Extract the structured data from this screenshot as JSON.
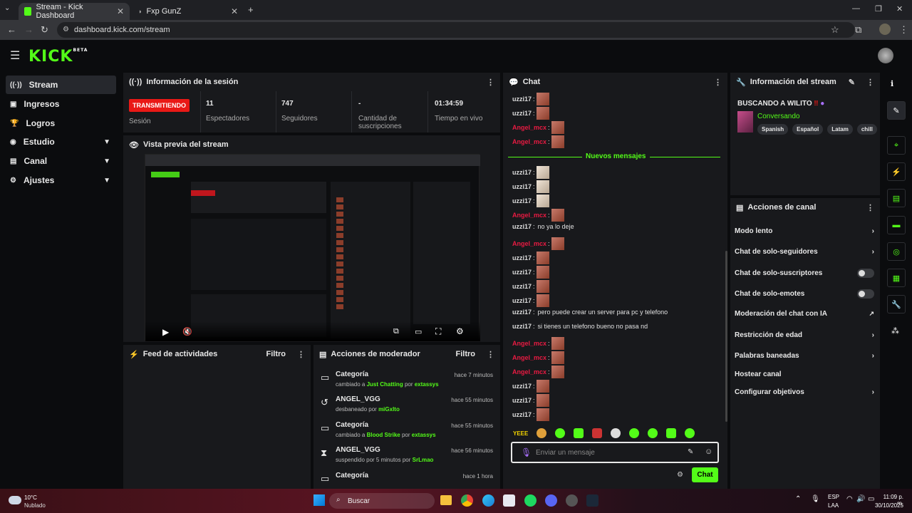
{
  "browser": {
    "tabs": [
      {
        "title": "Stream - Kick Dashboard",
        "active": true
      },
      {
        "title": "Fxp GunZ",
        "active": false
      }
    ],
    "url": "dashboard.kick.com/stream"
  },
  "header": {
    "logo": "KICK",
    "beta": "BETA"
  },
  "sidebar": {
    "items": [
      {
        "label": "Stream",
        "icon": "broadcast-icon"
      },
      {
        "label": "Ingresos",
        "icon": "money-icon"
      },
      {
        "label": "Logros",
        "icon": "trophy-icon"
      },
      {
        "label": "Estudio",
        "icon": "studio-icon"
      },
      {
        "label": "Canal",
        "icon": "channel-icon"
      },
      {
        "label": "Ajustes",
        "icon": "gear-icon"
      }
    ]
  },
  "session": {
    "title": "Información de la sesión",
    "live_badge": "TRANSMITIENDO",
    "session_label": "Sesión",
    "stats": [
      {
        "value": "11",
        "label": "Espectadores"
      },
      {
        "value": "747",
        "label": "Seguidores"
      },
      {
        "value": "-",
        "label": "Cantidad de suscripciones"
      },
      {
        "value": "01:34:59",
        "label": "Tiempo en vivo"
      }
    ]
  },
  "preview": {
    "title": "Vista previa del stream"
  },
  "activity": {
    "title": "Feed de actividades",
    "filter": "Filtro"
  },
  "moderator": {
    "title": "Acciones de moderador",
    "filter": "Filtro",
    "items": [
      {
        "title": "Categoría",
        "time": "hace 7 minutos",
        "pre": "cambiado a",
        "target": "Just Chatting",
        "mid": "por",
        "by": "extassys"
      },
      {
        "title": "ANGEL_VGG",
        "time": "hace 55 minutos",
        "pre": "desbaneado por",
        "target": "",
        "mid": "",
        "by": "miGxlto"
      },
      {
        "title": "Categoría",
        "time": "hace 55 minutos",
        "pre": "cambiado a",
        "target": "Blood Strike",
        "mid": "por",
        "by": "extassys"
      },
      {
        "title": "ANGEL_VGG",
        "time": "hace 56 minutos",
        "pre": "suspendido por 5 minutos por",
        "target": "",
        "mid": "",
        "by": "SrLmao"
      },
      {
        "title": "Categoría",
        "time": "hace 1 hora",
        "pre": "",
        "target": "",
        "mid": "",
        "by": ""
      }
    ]
  },
  "chat": {
    "title": "Chat",
    "new_messages": "Nuevos mensajes",
    "messages": [
      {
        "user": "uzzi17",
        "text": "",
        "emote": true
      },
      {
        "user": "uzzi17",
        "text": "",
        "emote": true
      },
      {
        "user": "Angel_mcx",
        "text": "",
        "emote": true
      },
      {
        "user": "Angel_mcx",
        "text": "",
        "emote": true
      },
      {
        "user": "uzzi17",
        "text": "",
        "emote": true
      },
      {
        "user": "uzzi17",
        "text": "",
        "emote": true
      },
      {
        "user": "uzzi17",
        "text": "",
        "emote": true
      },
      {
        "user": "Angel_mcx",
        "text": "",
        "emote": true
      },
      {
        "user": "uzzi17",
        "text": "no ya lo deje",
        "emote": false
      },
      {
        "user": "Angel_mcx",
        "text": "",
        "emote": true
      },
      {
        "user": "uzzi17",
        "text": "",
        "emote": true
      },
      {
        "user": "uzzi17",
        "text": "",
        "emote": true
      },
      {
        "user": "uzzi17",
        "text": "",
        "emote": true
      },
      {
        "user": "uzzi17",
        "text": "",
        "emote": true
      },
      {
        "user": "uzzi17",
        "text": "pero puede crear un server para pc y telefono",
        "emote": false
      },
      {
        "user": "uzzi17",
        "text": "si tienes un telefono bueno no pasa nd",
        "emote": false
      },
      {
        "user": "Angel_mcx",
        "text": "",
        "emote": true
      },
      {
        "user": "Angel_mcx",
        "text": "",
        "emote": true
      },
      {
        "user": "Angel_mcx",
        "text": "",
        "emote": true
      },
      {
        "user": "uzzi17",
        "text": "",
        "emote": true
      },
      {
        "user": "uzzi17",
        "text": "",
        "emote": true
      },
      {
        "user": "uzzi17",
        "text": "",
        "emote": true
      }
    ],
    "input_placeholder": "Enviar un mensaje",
    "send_label": "Chat",
    "quick_emote": "YEEE"
  },
  "stream_info": {
    "title": "Información del stream",
    "stream_title": "BUSCANDO A WILITO",
    "category": "Conversando",
    "tags": [
      "Spanish",
      "Español",
      "Latam",
      "chill"
    ]
  },
  "channel_actions": {
    "title": "Acciones de canal",
    "items": [
      {
        "label": "Modo lento",
        "control": "chevron"
      },
      {
        "label": "Chat de solo-seguidores",
        "control": "chevron"
      },
      {
        "label": "Chat de solo-suscriptores",
        "control": "toggle"
      },
      {
        "label": "Chat de solo-emotes",
        "control": "toggle"
      },
      {
        "label": "Moderación del chat con IA",
        "control": "external"
      },
      {
        "label": "Restricción de edad",
        "control": "chevron"
      },
      {
        "label": "Palabras baneadas",
        "control": "chevron"
      },
      {
        "label": "Hostear canal",
        "control": "none"
      },
      {
        "label": "Configurar objetivos",
        "control": "chevron"
      }
    ]
  },
  "taskbar": {
    "weather_temp": "10°C",
    "weather_desc": "Nublado",
    "search": "Buscar",
    "lang": "ESP",
    "lang2": "LAA",
    "time": "11:09 p. m.",
    "date": "30/10/2025"
  },
  "colors": {
    "brand": "#53fc18",
    "live": "#e91916",
    "angel": "#e91a42"
  }
}
